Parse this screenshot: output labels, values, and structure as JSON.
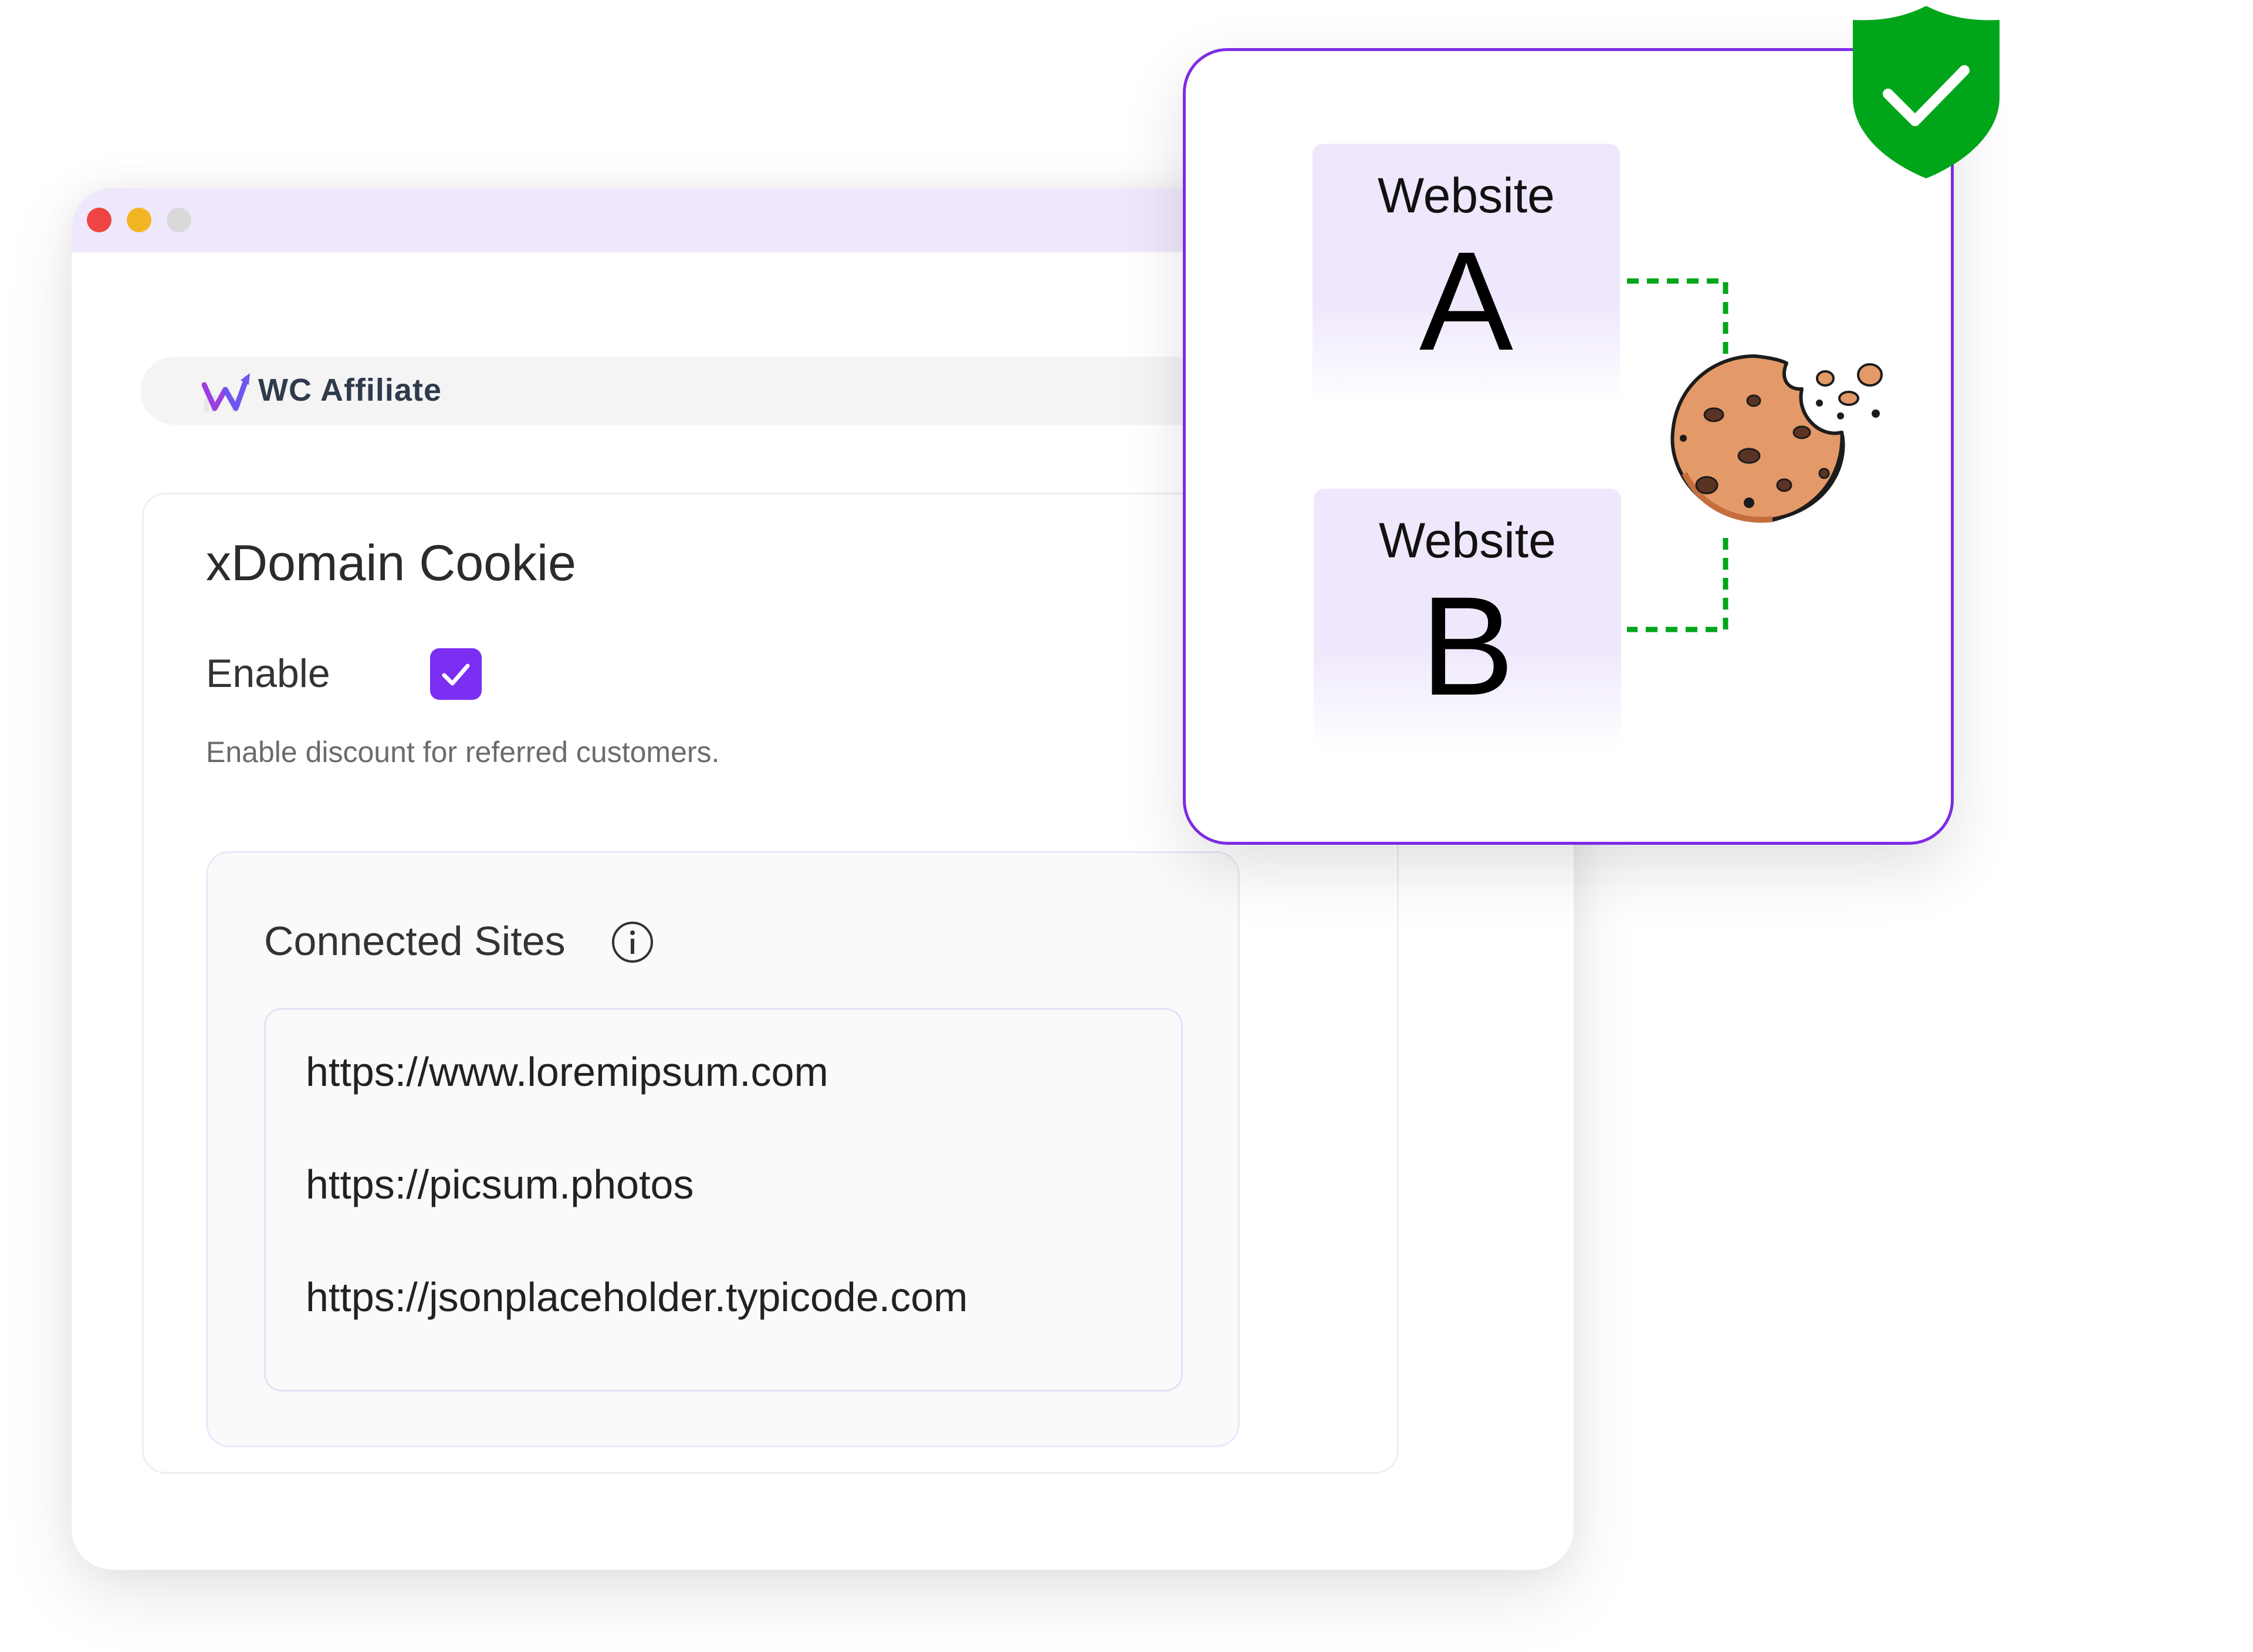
{
  "window": {
    "controls": [
      "close",
      "minimize",
      "zoom"
    ]
  },
  "brand": {
    "name": "WC Affiliate",
    "logo_icon": "wc-affiliate-logo-icon"
  },
  "settings": {
    "title": "xDomain Cookie",
    "enable_label": "Enable",
    "enable_checked": true,
    "enable_help": "Enable discount for referred customers.",
    "connected_sites": {
      "title": "Connected Sites",
      "info_icon": "info-icon",
      "sites": [
        "https://www.loremipsum.com",
        "https://picsum.photos",
        "https://jsonplaceholder.typicode.com"
      ]
    }
  },
  "illustration": {
    "site_a": {
      "word": "Website",
      "letter": "A"
    },
    "site_b": {
      "word": "Website",
      "letter": "B"
    },
    "cookie_icon": "cookie-icon",
    "shield_icon": "shield-check-icon"
  },
  "colors": {
    "accent": "#7b2ff2",
    "overlay_border": "#7e2be4",
    "connector": "#00a51a",
    "shield": "#00a51a",
    "titlebar": "#efe7fb",
    "close_dot": "#ef4444",
    "minimize_dot": "#f4b524",
    "zoom_dot": "#d9d9d9"
  }
}
